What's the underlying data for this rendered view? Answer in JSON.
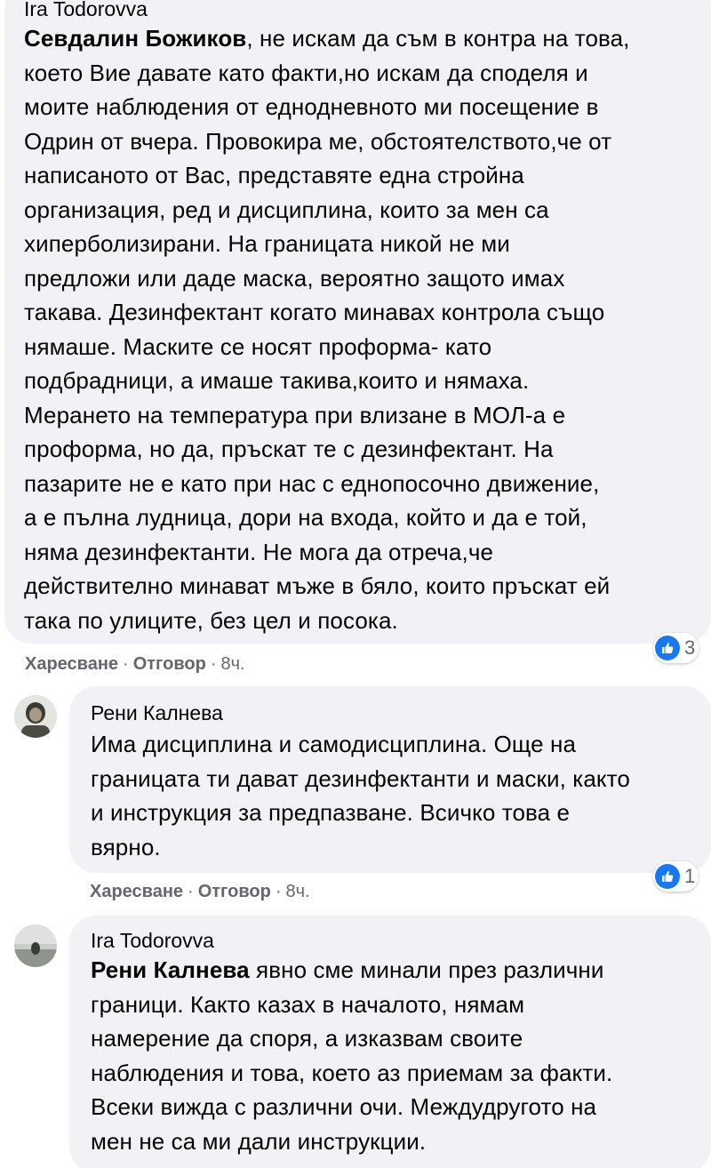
{
  "comments": [
    {
      "author": "Ira Todorovva",
      "mention": "Севдалин Божиков",
      "lines": [
        ", не искам да съм в контра на това,",
        "което Вие давате като факти,но искам да споделя и",
        "моите наблюдения от еднодневното ми посещение в",
        "Одрин от вчера. Провокира ме, обстоятелството,че от",
        "написаното от Вас, представяте една стройна",
        "организация, ред и дисциплина, които за мен са",
        "хиперболизирани. На границата никой не ми",
        "предложи или даде маска, вероятно защото имах",
        "такава. Дезинфектант когато минавах контрола също",
        "нямаше. Маските се носят проформа- като",
        "подбрадници, а имаше такива,които и нямаха.",
        "Мерането на температура при влизане в МОЛ-а е",
        "проформа, но да, пръскат те с дезинфектант. На",
        "пазарите не е като при нас с еднопосочно движение,",
        "а е пълна лудница, дори на входа, който и да е той,",
        "няма дезинфектанти. Не мога да отреча,че",
        "действително минават мъже в бяло, които пръскат ей",
        "така по улиците, без цел и посока."
      ],
      "actions": {
        "like": "Харесване",
        "sep": "·",
        "reply": "Отговор",
        "time": "8ч."
      },
      "reactions": "3"
    },
    {
      "author": "Рени Калнева",
      "lines": [
        "Има дисциплина и самодисциплина. Още на",
        "границата ти дават дезинфектанти и маски, както",
        "и инструкция за предпазване. Всичко това е",
        "вярно."
      ],
      "actions": {
        "like": "Харесване",
        "sep": "·",
        "reply": "Отговор",
        "time": "8ч."
      },
      "reactions": "1"
    },
    {
      "author": "Ira Todorovva",
      "mention": "Рени Калнева",
      "lines": [
        " явно сме минали през различни",
        "граници. Както казах в началото, нямам",
        "намерение да споря, а изказвам своите",
        "наблюдения и това, което аз приемам за факти.",
        "Всеки вижда с различни очи. Междудругото на",
        "мен не са ми дали инструкции."
      ]
    }
  ],
  "colors": {
    "bubble": "#f0f2f5",
    "meta": "#65676b",
    "like_blue": "#1877f2"
  },
  "icons": [
    "like-icon",
    "avatar"
  ]
}
